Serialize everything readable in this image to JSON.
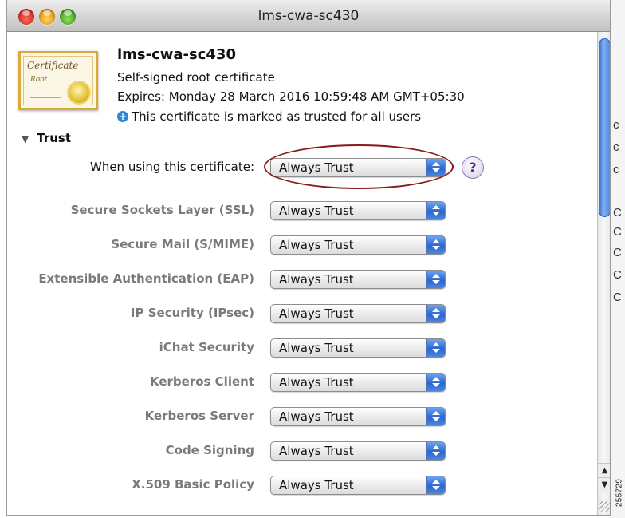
{
  "window": {
    "title": "lms-cwa-sc430"
  },
  "certificate": {
    "icon_text": "Certificate",
    "icon_subtext": "Root",
    "name": "lms-cwa-sc430",
    "type": "Self-signed root certificate",
    "expires": "Expires: Monday 28 March 2016 10:59:48 AM GMT+05:30",
    "trust_note": "This certificate is marked as trusted for all users"
  },
  "trust": {
    "section_label": "Trust",
    "main_setting": {
      "label": "When using this certificate:",
      "value": "Always Trust"
    },
    "settings": [
      {
        "label": "Secure Sockets Layer (SSL)",
        "value": "Always Trust"
      },
      {
        "label": "Secure Mail (S/MIME)",
        "value": "Always Trust"
      },
      {
        "label": "Extensible Authentication (EAP)",
        "value": "Always Trust"
      },
      {
        "label": "IP Security (IPsec)",
        "value": "Always Trust"
      },
      {
        "label": "iChat Security",
        "value": "Always Trust"
      },
      {
        "label": "Kerberos Client",
        "value": "Always Trust"
      },
      {
        "label": "Kerberos Server",
        "value": "Always Trust"
      },
      {
        "label": "Code Signing",
        "value": "Always Trust"
      },
      {
        "label": "X.509 Basic Policy",
        "value": "Always Trust"
      }
    ]
  },
  "help_label": "?",
  "background_glyphs": [
    "c",
    "c",
    "c",
    "C",
    "C",
    "C",
    "C",
    "C"
  ],
  "figure_id": "255729",
  "colors": {
    "accent_blue": "#2c66cf",
    "highlight_ellipse": "#8a1a1a"
  }
}
